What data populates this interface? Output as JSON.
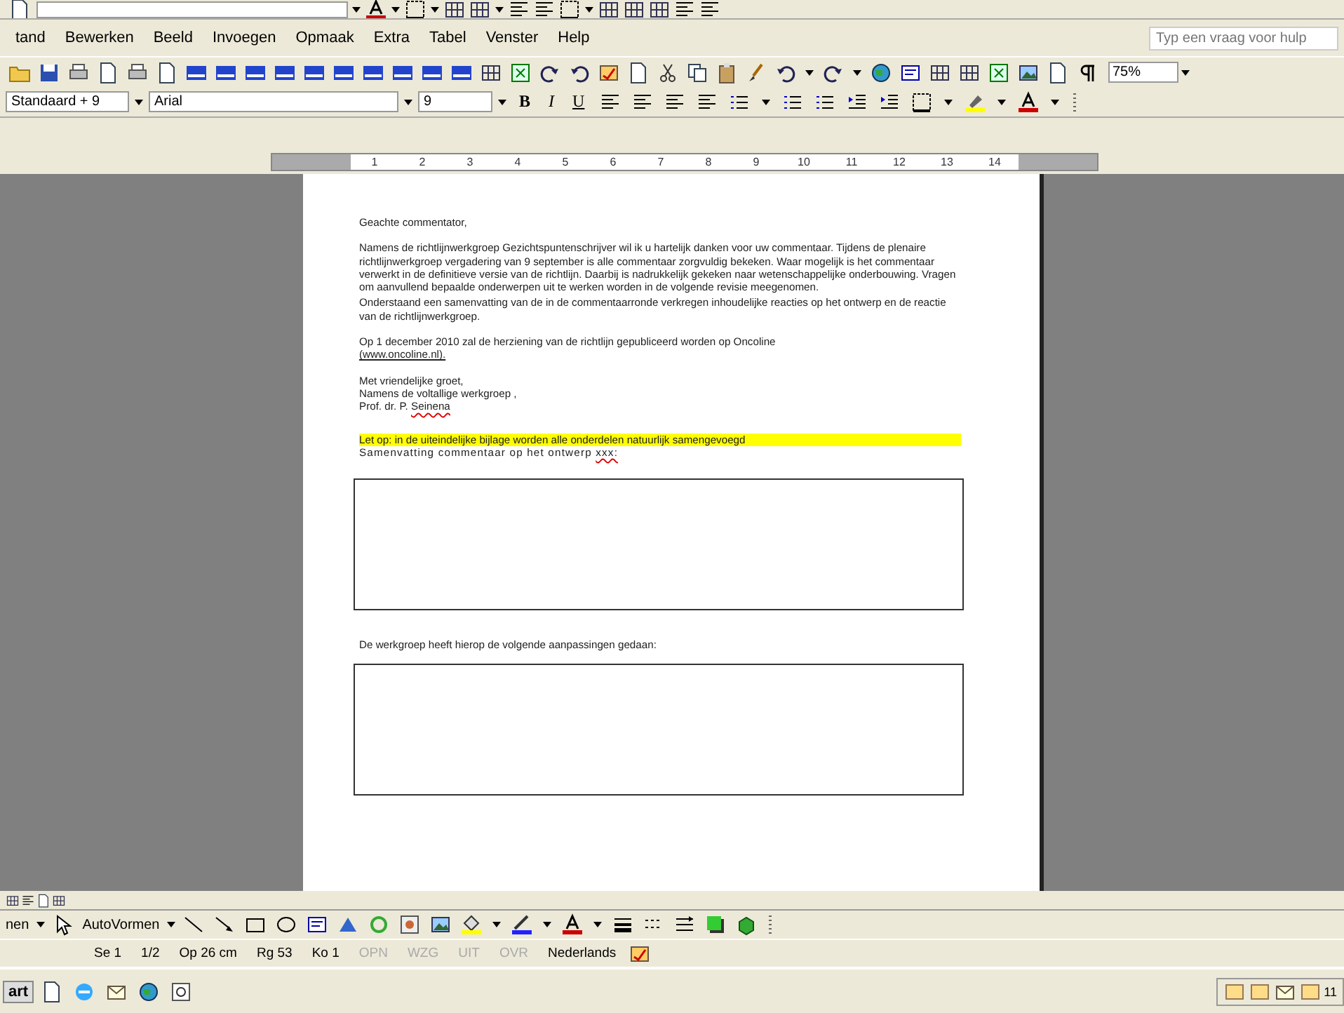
{
  "menu_bar": {
    "items": [
      {
        "label": "tand"
      },
      {
        "label": "Bewerken"
      },
      {
        "label": "Beeld"
      },
      {
        "label": "Invoegen"
      },
      {
        "label": "Opmaak"
      },
      {
        "label": "Extra"
      },
      {
        "label": "Tabel"
      },
      {
        "label": "Venster"
      },
      {
        "label": "Help"
      }
    ],
    "help_placeholder": "Typ een vraag voor hulp"
  },
  "standard_toolbar": {
    "zoom": "75%"
  },
  "formatting_toolbar": {
    "style": "Standaard + 9",
    "font": "Arial",
    "size": "9",
    "bold": "B",
    "italic": "I",
    "underline": "U"
  },
  "ruler": {
    "marks": [
      "1",
      "2",
      "3",
      "4",
      "5",
      "6",
      "7",
      "8",
      "9",
      "10",
      "11",
      "12",
      "13",
      "14"
    ]
  },
  "document": {
    "blocks": [
      {
        "kind": "p",
        "text": "Geachte commentator,"
      },
      {
        "kind": "p",
        "text": "Namens de richtlijnwerkgroep Gezichtspuntenschrijver wil ik u hartelijk danken voor uw commentaar. Tijdens de plenaire richtlijnwerkgroep vergadering van 9 september is alle commentaar zorgvuldig bekeken. Waar mogelijk is het commentaar verwerkt in de definitieve versie van de richtlijn. Daarbij is nadrukkelijk gekeken naar wetenschappelijke onderbouwing. Vragen om aanvullend bepaalde onderwerpen uit te werken worden in de volgende revisie meegenomen."
      },
      {
        "kind": "tight",
        "text": "Onderstaand een samenvatting van de in de commentaarronde verkregen inhoudelijke reacties op het ontwerp en de reactie van de richtlijnwerkgroep."
      },
      {
        "kind": "p",
        "text": "Op 1 december 2010 zal de herziening van de richtlijn gepubliceerd worden op Oncoline",
        "underlined": "(www.oncoline.nl)."
      },
      {
        "kind": "lines",
        "lines": [
          "Met vriendelijke groet,",
          "Namens de voltallige werkgroep ,"
        ]
      },
      {
        "kind": "signature",
        "text": "Prof. dr. P.",
        "underlined": "Seinena"
      },
      {
        "kind": "highlight",
        "text": "Let op: in de uiteindelijke bijlage worden alle onderdelen natuurlijk samengevoegd"
      },
      {
        "kind": "wide",
        "text": "Samenvatting commentaar op het ontwerp",
        "underlined": "xxx:"
      },
      {
        "kind": "box"
      },
      {
        "kind": "p",
        "text": "De werkgroep heeft hierop de volgende aanpassingen gedaan:"
      },
      {
        "kind": "box"
      }
    ]
  },
  "drawing_toolbar": {
    "draw_label": "nen",
    "autoshapes_label": "AutoVormen"
  },
  "status_bar": {
    "items": [
      {
        "text": "Se 1",
        "disabled": false
      },
      {
        "text": "1/2",
        "disabled": false
      },
      {
        "text": "Op 26 cm",
        "disabled": false
      },
      {
        "text": "Rg 53",
        "disabled": false
      },
      {
        "text": "Ko 1",
        "disabled": false
      },
      {
        "text": "OPN",
        "disabled": true
      },
      {
        "text": "WZG",
        "disabled": true
      },
      {
        "text": "UIT",
        "disabled": true
      },
      {
        "text": "OVR",
        "disabled": true
      },
      {
        "text": "Nederlands",
        "disabled": false
      }
    ]
  },
  "taskbar": {
    "start": "art",
    "clock": "11"
  }
}
